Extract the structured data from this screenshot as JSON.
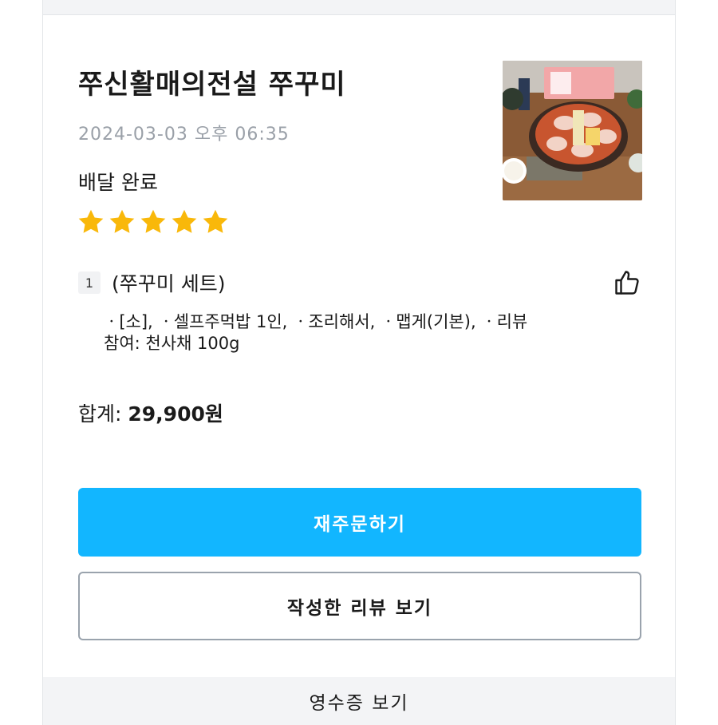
{
  "order": {
    "restaurant_name": "쭈신활매의전설 쭈꾸미",
    "datetime": "2024-03-03 오후 06:35",
    "status": "배달 완료",
    "rating": 5,
    "rating_color": "#f9b80a"
  },
  "item": {
    "quantity": "1",
    "name": "(쭈꾸미 세트)",
    "options_line1": "ㆍ[소], ㆍ셀프주먹밥 1인, ㆍ조리해서, ㆍ맵게(기본), ㆍ리뷰",
    "options_line2": "참여: 천사채 100g"
  },
  "total": {
    "label": "합계:",
    "amount": "29,900원"
  },
  "buttons": {
    "reorder_label": "재주문하기",
    "view_review_label": "작성한 리뷰 보기",
    "receipt_label": "영수증 보기"
  },
  "colors": {
    "primary": "#12b6ff",
    "muted_text": "#9aa0a8"
  },
  "icons": {
    "like": "thumbs-up-icon",
    "photo": "food-photo"
  }
}
